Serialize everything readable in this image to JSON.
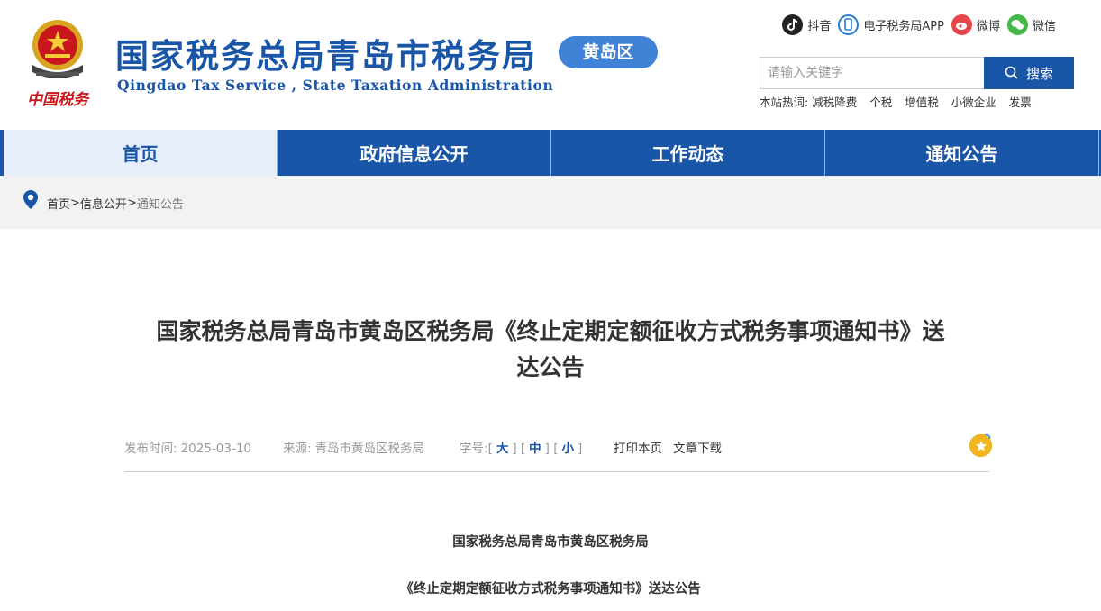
{
  "header": {
    "title_cn": "国家税务总局青岛市税务局",
    "title_en": "Qingdao Tax Service , State Taxation Administration",
    "district": "黄岛区",
    "logo_text": "中国税务"
  },
  "social": [
    {
      "label": "抖音",
      "icon": "douyin-icon",
      "color": "#222222"
    },
    {
      "label": "电子税务局APP",
      "icon": "mobile-app-icon",
      "color": "#2a7ed9"
    },
    {
      "label": "微博",
      "icon": "weibo-icon",
      "color": "#e6454a"
    },
    {
      "label": "微信",
      "icon": "wechat-icon",
      "color": "#46b84a"
    }
  ],
  "search": {
    "placeholder": "请输入关键字",
    "button_label": "搜索",
    "hot_label": "本站热词:",
    "hot_words": [
      "减税降费",
      "个税",
      "增值税",
      "小微企业",
      "发票"
    ]
  },
  "nav": {
    "items": [
      {
        "label": "首页",
        "active": true
      },
      {
        "label": "政府信息公开",
        "active": false
      },
      {
        "label": "工作动态",
        "active": false
      },
      {
        "label": "通知公告",
        "active": false
      }
    ]
  },
  "breadcrumb": {
    "home": "首页",
    "sep": ">",
    "level1": "信息公开",
    "current": "通知公告"
  },
  "article": {
    "title_line1": "国家税务总局青岛市黄岛区税务局《终止定期定额征收方式税务事项通知书》送",
    "title_line2": "达公告",
    "publish_label": "发布时间:",
    "publish_date": "2025-03-10",
    "source_label": "来源:",
    "source": "青岛市黄岛区税务局",
    "font_label": "字号:",
    "font_sizes": [
      "大",
      "中",
      "小"
    ],
    "print": "打印本页",
    "download": "文章下载",
    "body_heading1": "国家税务总局青岛市黄岛区税务局",
    "body_heading2": "《终止定期定额征收方式税务事项通知书》送达公告"
  },
  "colors": {
    "brand_blue": "#1a56a8",
    "nav_active_bg": "#e6eef9",
    "badge_blue": "#3f82d6"
  }
}
